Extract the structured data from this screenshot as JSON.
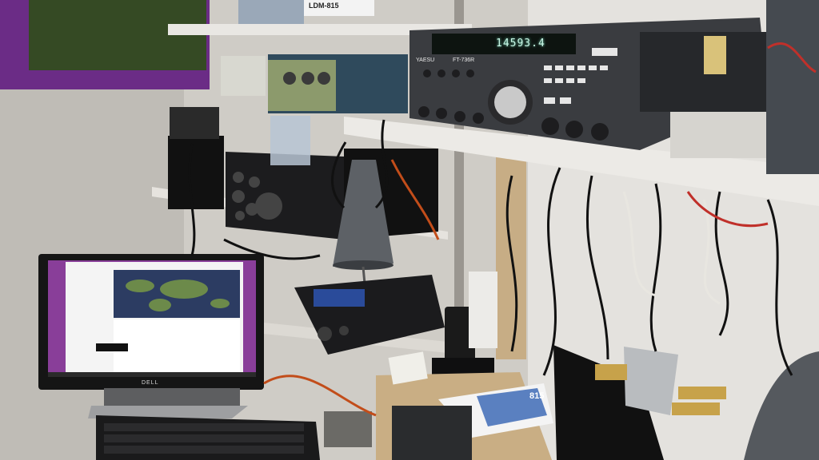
{
  "labels": {
    "label_box_top": "LDM-815",
    "transceiver_display": "14593.4",
    "transceiver_model": "FT-736R",
    "transceiver_brand": "YAESU",
    "monitor_brand": "DELL",
    "magazine_number": "815"
  },
  "colors": {
    "wall": "#d8d6d1",
    "shelf": "#e8e6e2",
    "radio_body": "#3a3c40",
    "cable": "#111111",
    "monitor_wallpaper": "#7b3fa0",
    "window_frame": "#6b2c86"
  }
}
